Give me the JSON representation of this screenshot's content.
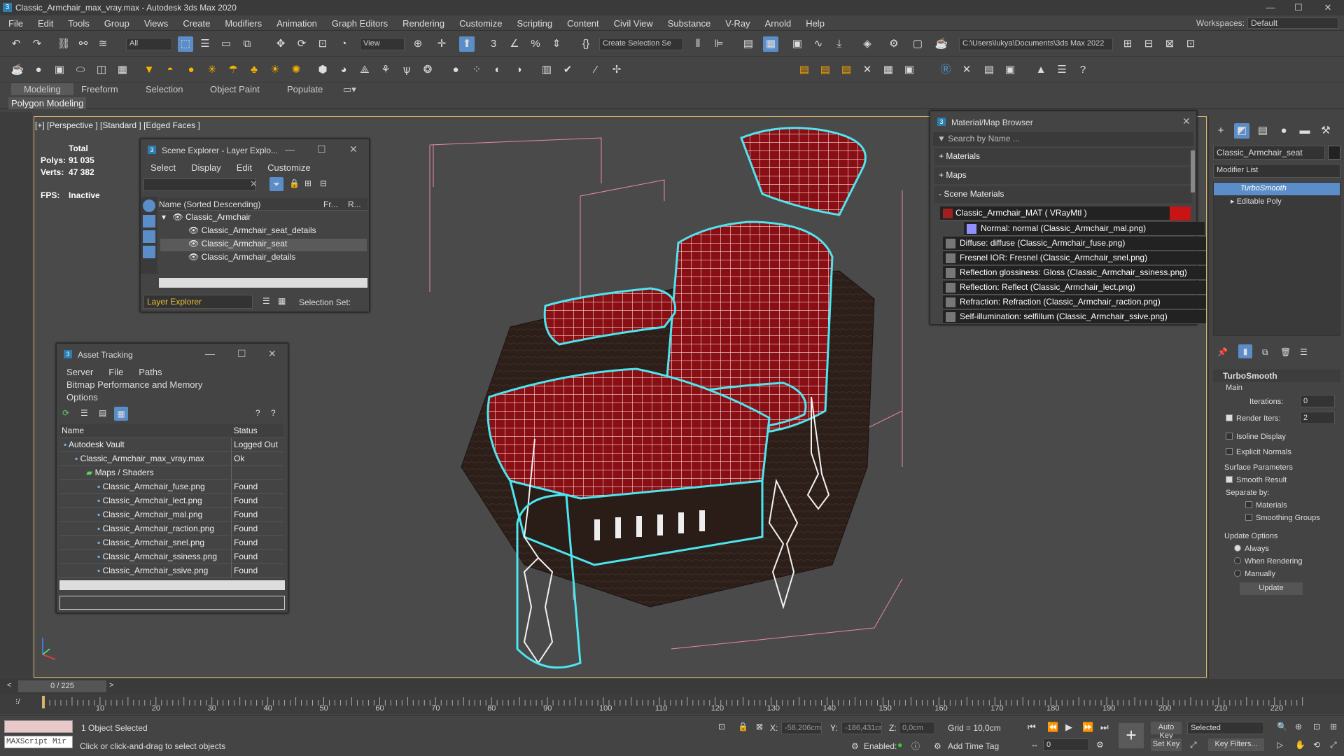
{
  "window": {
    "title": "Classic_Armchair_max_vray.max - Autodesk 3ds Max 2020",
    "min": "—",
    "max": "☐",
    "close": "✕"
  },
  "menu": {
    "items": [
      "File",
      "Edit",
      "Tools",
      "Group",
      "Views",
      "Create",
      "Modifiers",
      "Animation",
      "Graph Editors",
      "Rendering",
      "Customize",
      "Scripting",
      "Content",
      "Civil View",
      "Substance",
      "V-Ray",
      "Arnold",
      "Help"
    ],
    "workspace_label": "Workspaces:",
    "workspace_value": "Default"
  },
  "toolbar": {
    "filter": "All",
    "view": "View",
    "selection_set": "Create Selection Se",
    "path": "C:\\Users\\lukya\\Documents\\3ds Max 2022"
  },
  "ribbon": {
    "tabs": [
      "Modeling",
      "Freeform",
      "Selection",
      "Object Paint",
      "Populate"
    ],
    "active": "Modeling",
    "sub": "Polygon Modeling"
  },
  "viewport": {
    "label": "[+] [Perspective ] [Standard ] [Edged Faces ]",
    "stats": {
      "total": "Total",
      "polys_label": "Polys:",
      "polys": "91 035",
      "verts_label": "Verts:",
      "verts": "47 382",
      "fps_label": "FPS:",
      "fps": "Inactive"
    }
  },
  "scene_explorer": {
    "title": "Scene Explorer - Layer Explo...",
    "menu": [
      "Select",
      "Display",
      "Edit",
      "Customize"
    ],
    "col_name": "Name (Sorted Descending)",
    "col_fr": "Fr...",
    "col_r": "R...",
    "root": "Classic_Armchair",
    "rows": [
      "Classic_Armchair_seat_details",
      "Classic_Armchair_seat",
      "Classic_Armchair_details"
    ],
    "selected": "Classic_Armchair_seat",
    "layer_dropdown": "Layer Explorer",
    "selection_set": "Selection Set:"
  },
  "asset_tracking": {
    "title": "Asset Tracking",
    "menu": [
      "Server",
      "File",
      "Paths",
      "Bitmap Performance and Memory"
    ],
    "menu2": "Options",
    "col_name": "Name",
    "col_status": "Status",
    "rows": [
      {
        "name": "Autodesk Vault",
        "status": "Logged Out",
        "indent": 0
      },
      {
        "name": "Classic_Armchair_max_vray.max",
        "status": "Ok",
        "indent": 1
      },
      {
        "name": "Maps / Shaders",
        "status": "",
        "indent": 2
      },
      {
        "name": "Classic_Armchair_fuse.png",
        "status": "Found",
        "indent": 3
      },
      {
        "name": "Classic_Armchair_lect.png",
        "status": "Found",
        "indent": 3
      },
      {
        "name": "Classic_Armchair_mal.png",
        "status": "Found",
        "indent": 3
      },
      {
        "name": "Classic_Armchair_raction.png",
        "status": "Found",
        "indent": 3
      },
      {
        "name": "Classic_Armchair_snel.png",
        "status": "Found",
        "indent": 3
      },
      {
        "name": "Classic_Armchair_ssiness.png",
        "status": "Found",
        "indent": 3
      },
      {
        "name": "Classic_Armchair_ssive.png",
        "status": "Found",
        "indent": 3
      }
    ]
  },
  "material_browser": {
    "title": "Material/Map Browser",
    "search": "Search by Name ...",
    "sections": [
      "+ Materials",
      "+ Maps",
      "- Scene Materials"
    ],
    "mat": "Classic_Armchair_MAT  ( VRayMtl )",
    "maps": [
      "Normal: normal (Classic_Armchair_mal.png)",
      "Diffuse: diffuse (Classic_Armchair_fuse.png)",
      "Fresnel IOR: Fresnel (Classic_Armchair_snel.png)",
      "Reflection glossiness: Gloss (Classic_Armchair_ssiness.png)",
      "Reflection: Reflect (Classic_Armchair_lect.png)",
      "Refraction: Refraction (Classic_Armchair_raction.png)",
      "Self-illumination: selfillum (Classic_Armchair_ssive.png)"
    ]
  },
  "command_panel": {
    "object_name": "Classic_Armchair_seat",
    "modifier_list": "Modifier List",
    "stack": [
      "TurboSmooth",
      "Editable Poly"
    ],
    "rollout": "TurboSmooth",
    "main": "Main",
    "iterations_label": "Iterations:",
    "iterations": "0",
    "render_iters_label": "Render Iters:",
    "render_iters": "2",
    "isoline": "Isoline Display",
    "explicit": "Explicit Normals",
    "surface": "Surface Parameters",
    "smooth": "Smooth Result",
    "separate": "Separate by:",
    "materials": "Materials",
    "smoothing": "Smoothing Groups",
    "update_options": "Update Options",
    "always": "Always",
    "when_rendering": "When Rendering",
    "manually": "Manually",
    "update_btn": "Update"
  },
  "timeline": {
    "frame": "0 / 225",
    "ticks": [
      "10",
      "20",
      "30",
      "40",
      "50",
      "60",
      "70",
      "80",
      "90",
      "100",
      "110",
      "120",
      "130",
      "140",
      "150",
      "160",
      "170",
      "180",
      "190",
      "200",
      "210",
      "220"
    ]
  },
  "status": {
    "maxscript": "MAXScript Mir",
    "selected": "1 Object Selected",
    "prompt": "Click or click-and-drag to select objects",
    "x_label": "X:",
    "x": "-58,206cm",
    "y_label": "Y:",
    "y": "-186,431cm",
    "z_label": "Z:",
    "z": "0,0cm",
    "grid": "Grid = 10,0cm",
    "enabled": "Enabled:",
    "add_time_tag": "Add Time Tag",
    "auto_key": "Auto Key",
    "set_key": "Set Key",
    "selected_dd": "Selected",
    "key_filters": "Key Filters...",
    "frame_field": "0"
  }
}
